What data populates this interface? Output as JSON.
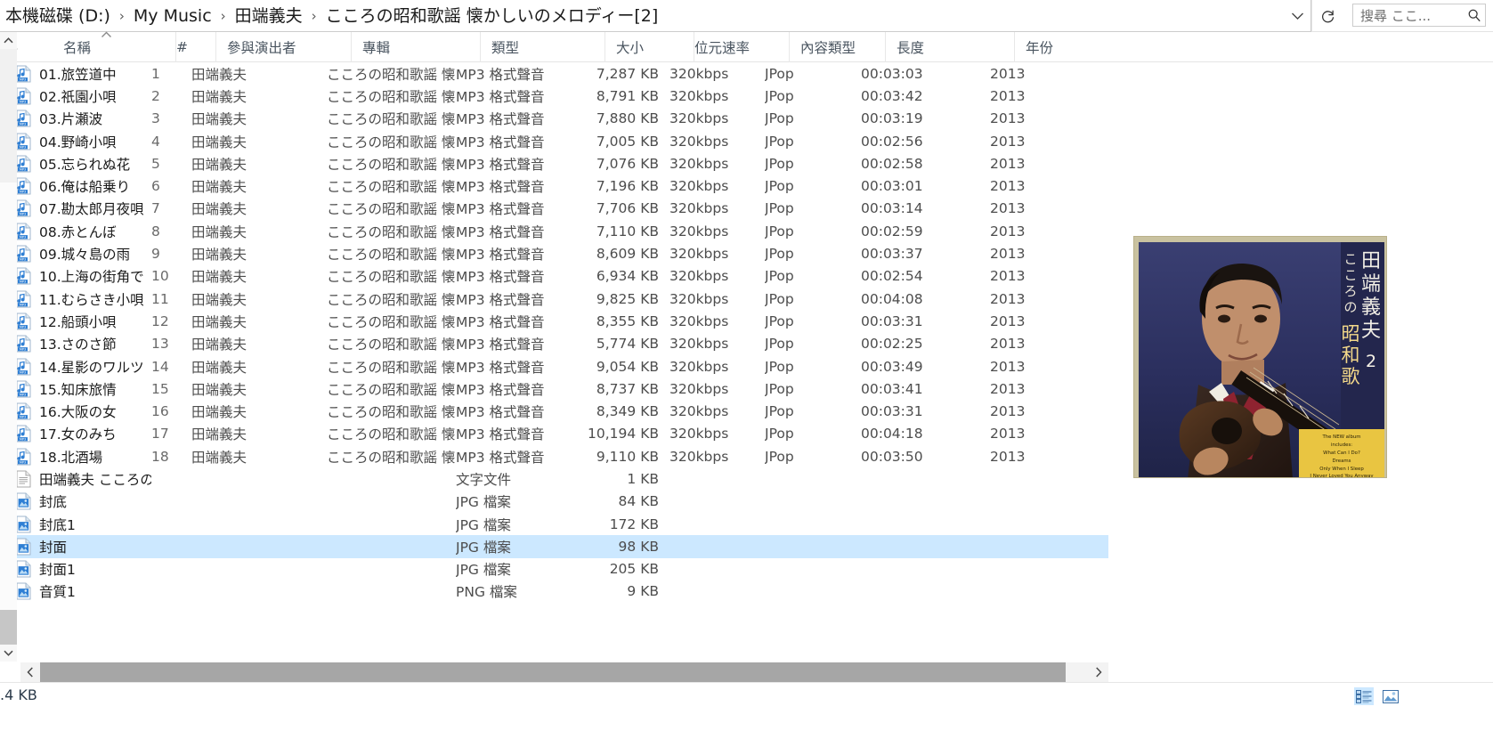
{
  "window": {
    "title": "こころの昭和歌謡 懐かしいのメロディー[2]"
  },
  "address_bar": {
    "crumbs": [
      {
        "label": "本機磁碟 (D:)"
      },
      {
        "label": "My Music"
      },
      {
        "label": "田端義夫"
      },
      {
        "label": "こころの昭和歌謡 懐かしいのメロディー[2]"
      }
    ],
    "separator": "›",
    "dropdown_icon": "chevron-down-icon",
    "refresh_icon": "refresh-icon"
  },
  "search": {
    "value": "搜尋 ここ...",
    "placeholder": "搜尋 ここ...",
    "icon": "search-icon"
  },
  "columns": [
    {
      "key": "name",
      "label": "名稱",
      "sorted": true,
      "sort_dir": "asc"
    },
    {
      "key": "track",
      "label": "#",
      "sorted": false
    },
    {
      "key": "artist",
      "label": "參與演出者",
      "sorted": false
    },
    {
      "key": "album",
      "label": "專輯",
      "sorted": false
    },
    {
      "key": "type",
      "label": "類型",
      "sorted": false
    },
    {
      "key": "size",
      "label": "大小",
      "sorted": false
    },
    {
      "key": "rate",
      "label": "位元速率",
      "sorted": false
    },
    {
      "key": "ctype",
      "label": "內容類型",
      "sorted": false
    },
    {
      "key": "len",
      "label": "長度",
      "sorted": false
    },
    {
      "key": "year",
      "label": "年份",
      "sorted": false
    }
  ],
  "rows": [
    {
      "icon": "mp3-file-icon",
      "name": "01.旅笠道中",
      "track": "1",
      "artist": "田端義夫",
      "album": "こころの昭和歌謡 懐...",
      "type": "MP3 格式聲音",
      "size": "7,287 KB",
      "rate": "320kbps",
      "ctype": "JPop",
      "len": "00:03:03",
      "year": "2013",
      "selected": false
    },
    {
      "icon": "mp3-file-icon",
      "name": "02.祇園小唄",
      "track": "2",
      "artist": "田端義夫",
      "album": "こころの昭和歌謡 懐...",
      "type": "MP3 格式聲音",
      "size": "8,791 KB",
      "rate": "320kbps",
      "ctype": "JPop",
      "len": "00:03:42",
      "year": "2013",
      "selected": false
    },
    {
      "icon": "mp3-file-icon",
      "name": "03.片瀬波",
      "track": "3",
      "artist": "田端義夫",
      "album": "こころの昭和歌謡 懐...",
      "type": "MP3 格式聲音",
      "size": "7,880 KB",
      "rate": "320kbps",
      "ctype": "JPop",
      "len": "00:03:19",
      "year": "2013",
      "selected": false
    },
    {
      "icon": "mp3-file-icon",
      "name": "04.野崎小唄",
      "track": "4",
      "artist": "田端義夫",
      "album": "こころの昭和歌謡 懐...",
      "type": "MP3 格式聲音",
      "size": "7,005 KB",
      "rate": "320kbps",
      "ctype": "JPop",
      "len": "00:02:56",
      "year": "2013",
      "selected": false
    },
    {
      "icon": "mp3-file-icon",
      "name": "05.忘られぬ花",
      "track": "5",
      "artist": "田端義夫",
      "album": "こころの昭和歌謡 懐...",
      "type": "MP3 格式聲音",
      "size": "7,076 KB",
      "rate": "320kbps",
      "ctype": "JPop",
      "len": "00:02:58",
      "year": "2013",
      "selected": false
    },
    {
      "icon": "mp3-file-icon",
      "name": "06.俺は船乗り",
      "track": "6",
      "artist": "田端義夫",
      "album": "こころの昭和歌謡 懐...",
      "type": "MP3 格式聲音",
      "size": "7,196 KB",
      "rate": "320kbps",
      "ctype": "JPop",
      "len": "00:03:01",
      "year": "2013",
      "selected": false
    },
    {
      "icon": "mp3-file-icon",
      "name": "07.勘太郎月夜唄",
      "track": "7",
      "artist": "田端義夫",
      "album": "こころの昭和歌謡 懐...",
      "type": "MP3 格式聲音",
      "size": "7,706 KB",
      "rate": "320kbps",
      "ctype": "JPop",
      "len": "00:03:14",
      "year": "2013",
      "selected": false
    },
    {
      "icon": "mp3-file-icon",
      "name": "08.赤とんぼ",
      "track": "8",
      "artist": "田端義夫",
      "album": "こころの昭和歌謡 懐...",
      "type": "MP3 格式聲音",
      "size": "7,110 KB",
      "rate": "320kbps",
      "ctype": "JPop",
      "len": "00:02:59",
      "year": "2013",
      "selected": false
    },
    {
      "icon": "mp3-file-icon",
      "name": "09.城々島の雨",
      "track": "9",
      "artist": "田端義夫",
      "album": "こころの昭和歌謡 懐...",
      "type": "MP3 格式聲音",
      "size": "8,609 KB",
      "rate": "320kbps",
      "ctype": "JPop",
      "len": "00:03:37",
      "year": "2013",
      "selected": false
    },
    {
      "icon": "mp3-file-icon",
      "name": "10.上海の街角で",
      "track": "10",
      "artist": "田端義夫",
      "album": "こころの昭和歌謡 懐...",
      "type": "MP3 格式聲音",
      "size": "6,934 KB",
      "rate": "320kbps",
      "ctype": "JPop",
      "len": "00:02:54",
      "year": "2013",
      "selected": false
    },
    {
      "icon": "mp3-file-icon",
      "name": "11.むらさき小唄",
      "track": "11",
      "artist": "田端義夫",
      "album": "こころの昭和歌謡 懐...",
      "type": "MP3 格式聲音",
      "size": "9,825 KB",
      "rate": "320kbps",
      "ctype": "JPop",
      "len": "00:04:08",
      "year": "2013",
      "selected": false
    },
    {
      "icon": "mp3-file-icon",
      "name": "12.船頭小唄",
      "track": "12",
      "artist": "田端義夫",
      "album": "こころの昭和歌謡 懐...",
      "type": "MP3 格式聲音",
      "size": "8,355 KB",
      "rate": "320kbps",
      "ctype": "JPop",
      "len": "00:03:31",
      "year": "2013",
      "selected": false
    },
    {
      "icon": "mp3-file-icon",
      "name": "13.さのさ節",
      "track": "13",
      "artist": "田端義夫",
      "album": "こころの昭和歌謡 懐...",
      "type": "MP3 格式聲音",
      "size": "5,774 KB",
      "rate": "320kbps",
      "ctype": "JPop",
      "len": "00:02:25",
      "year": "2013",
      "selected": false
    },
    {
      "icon": "mp3-file-icon",
      "name": "14.星影のワルツ",
      "track": "14",
      "artist": "田端義夫",
      "album": "こころの昭和歌謡 懐...",
      "type": "MP3 格式聲音",
      "size": "9,054 KB",
      "rate": "320kbps",
      "ctype": "JPop",
      "len": "00:03:49",
      "year": "2013",
      "selected": false
    },
    {
      "icon": "mp3-file-icon",
      "name": "15.知床旅情",
      "track": "15",
      "artist": "田端義夫",
      "album": "こころの昭和歌謡 懐...",
      "type": "MP3 格式聲音",
      "size": "8,737 KB",
      "rate": "320kbps",
      "ctype": "JPop",
      "len": "00:03:41",
      "year": "2013",
      "selected": false
    },
    {
      "icon": "mp3-file-icon",
      "name": "16.大阪の女",
      "track": "16",
      "artist": "田端義夫",
      "album": "こころの昭和歌謡 懐...",
      "type": "MP3 格式聲音",
      "size": "8,349 KB",
      "rate": "320kbps",
      "ctype": "JPop",
      "len": "00:03:31",
      "year": "2013",
      "selected": false
    },
    {
      "icon": "mp3-file-icon",
      "name": "17.女のみち",
      "track": "17",
      "artist": "田端義夫",
      "album": "こころの昭和歌謡 懐...",
      "type": "MP3 格式聲音",
      "size": "10,194 KB",
      "rate": "320kbps",
      "ctype": "JPop",
      "len": "00:04:18",
      "year": "2013",
      "selected": false
    },
    {
      "icon": "mp3-file-icon",
      "name": "18.北酒場",
      "track": "18",
      "artist": "田端義夫",
      "album": "こころの昭和歌謡 懐...",
      "type": "MP3 格式聲音",
      "size": "9,110 KB",
      "rate": "320kbps",
      "ctype": "JPop",
      "len": "00:03:50",
      "year": "2013",
      "selected": false
    },
    {
      "icon": "text-file-icon",
      "name": "田端義夫 こころの...",
      "track": "",
      "artist": "",
      "album": "",
      "type": "文字文件",
      "size": "1 KB",
      "rate": "",
      "ctype": "",
      "len": "",
      "year": "",
      "selected": false
    },
    {
      "icon": "jpg-file-icon",
      "name": "封底",
      "track": "",
      "artist": "",
      "album": "",
      "type": "JPG 檔案",
      "size": "84 KB",
      "rate": "",
      "ctype": "",
      "len": "",
      "year": "",
      "selected": false
    },
    {
      "icon": "jpg-file-icon",
      "name": "封底1",
      "track": "",
      "artist": "",
      "album": "",
      "type": "JPG 檔案",
      "size": "172 KB",
      "rate": "",
      "ctype": "",
      "len": "",
      "year": "",
      "selected": false
    },
    {
      "icon": "jpg-file-icon",
      "name": "封面",
      "track": "",
      "artist": "",
      "album": "",
      "type": "JPG 檔案",
      "size": "98 KB",
      "rate": "",
      "ctype": "",
      "len": "",
      "year": "",
      "selected": true
    },
    {
      "icon": "jpg-file-icon",
      "name": "封面1",
      "track": "",
      "artist": "",
      "album": "",
      "type": "JPG 檔案",
      "size": "205 KB",
      "rate": "",
      "ctype": "",
      "len": "",
      "year": "",
      "selected": false
    },
    {
      "icon": "png-file-icon",
      "name": "音質1",
      "track": "",
      "artist": "",
      "album": "",
      "type": "PNG 檔案",
      "size": "9 KB",
      "rate": "",
      "ctype": "",
      "len": "",
      "year": "",
      "selected": false
    }
  ],
  "preview": {
    "alt": "album-cover-photo-of-man-with-guitar",
    "overlay_title_lines": [
      "田",
      "端",
      "義",
      "夫"
    ],
    "overlay_subtitle_lines": [
      "こ",
      "こ",
      "ろ",
      "の"
    ],
    "overlay_big_lines": [
      "昭",
      "和",
      "歌"
    ],
    "badge_number": "2",
    "sticker_lines": [
      "The NEW album",
      "includes:",
      "What Can I Do?",
      "Dreams",
      "Only When I Sleep",
      "I Never Loved You Anyway"
    ]
  },
  "status_bar": {
    "text": ".4 KB"
  },
  "view_buttons": [
    {
      "name": "details-view-button",
      "icon": "details-view-icon",
      "active": true
    },
    {
      "name": "large-icons-view-button",
      "icon": "large-icons-view-icon",
      "active": false
    }
  ],
  "scrollbars": {
    "vertical_up_icon": "chevron-up-icon",
    "vertical_down_icon": "chevron-down-icon",
    "horizontal_left_icon": "chevron-left-icon",
    "horizontal_right_icon": "chevron-right-icon"
  },
  "colors": {
    "selection": "#cce8ff",
    "text": "#1b1b1b",
    "muted": "#4d4d4d",
    "header_text": "#4a5560",
    "scroll_thumb": "#a6a6a6"
  }
}
